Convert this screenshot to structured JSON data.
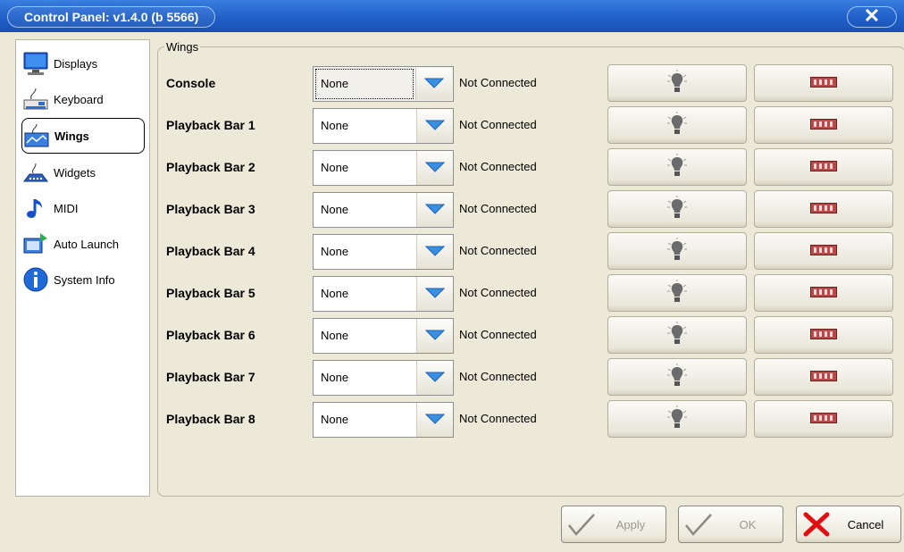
{
  "window": {
    "title": "Control Panel: v1.4.0 (b 5566)",
    "close_glyph": "✕"
  },
  "sidebar": {
    "items": [
      {
        "label": "Displays",
        "icon": "monitor-icon"
      },
      {
        "label": "Keyboard",
        "icon": "keyboard-icon"
      },
      {
        "label": "Wings",
        "icon": "wing-icon",
        "active": true
      },
      {
        "label": "Widgets",
        "icon": "widget-icon"
      },
      {
        "label": "MIDI",
        "icon": "music-note-icon"
      },
      {
        "label": "Auto Launch",
        "icon": "auto-launch-icon"
      },
      {
        "label": "System Info",
        "icon": "info-icon"
      }
    ]
  },
  "wings": {
    "group_title": "Wings",
    "rows": [
      {
        "label": "Console",
        "value": "None",
        "status": "Not Connected"
      },
      {
        "label": "Playback Bar 1",
        "value": "None",
        "status": "Not Connected"
      },
      {
        "label": "Playback Bar 2",
        "value": "None",
        "status": "Not Connected"
      },
      {
        "label": "Playback Bar 3",
        "value": "None",
        "status": "Not Connected"
      },
      {
        "label": "Playback Bar 4",
        "value": "None",
        "status": "Not Connected"
      },
      {
        "label": "Playback Bar 5",
        "value": "None",
        "status": "Not Connected"
      },
      {
        "label": "Playback Bar 6",
        "value": "None",
        "status": "Not Connected"
      },
      {
        "label": "Playback Bar 7",
        "value": "None",
        "status": "Not Connected"
      },
      {
        "label": "Playback Bar 8",
        "value": "None",
        "status": "Not Connected"
      }
    ],
    "row_icons": {
      "identify": "lightbulb-icon",
      "test": "fader-meter-icon"
    }
  },
  "footer": {
    "apply_label": "Apply",
    "ok_label": "OK",
    "cancel_label": "Cancel"
  },
  "colors": {
    "titlebar": "#1f5fc8",
    "dropdown_arrow": "#3a8fe0",
    "cancel_x": "#e01010",
    "checkmark": "#8a8a80"
  }
}
